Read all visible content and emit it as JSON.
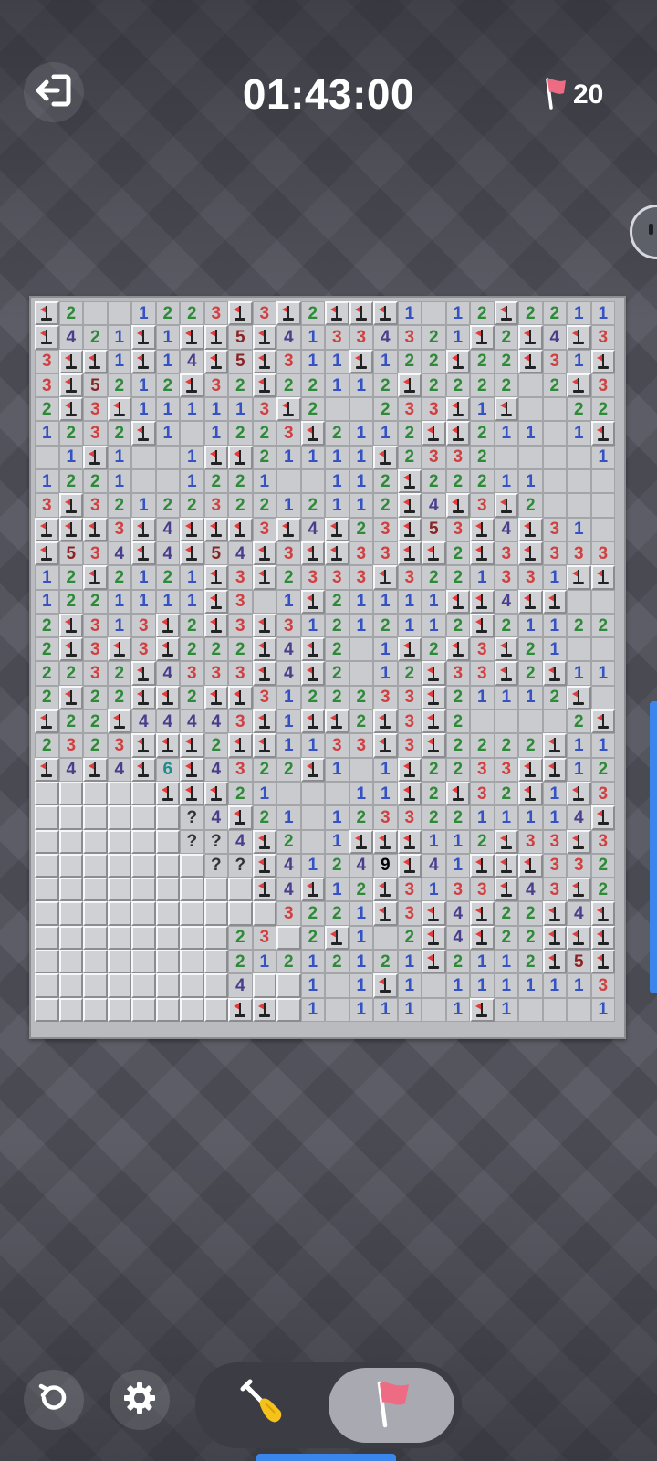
{
  "header": {
    "timer": "01:43:00",
    "flags_remaining": "20"
  },
  "colors": {
    "n1": "#3552c4",
    "n2": "#2d8a37",
    "n3": "#d14040",
    "n4": "#4a3e8c",
    "n5": "#8a2323",
    "n6": "#1e8c88",
    "flag_red": "#e33b3b",
    "flag_pink": "#ee6b84",
    "accent_blue": "#3b86ec"
  },
  "icons": {
    "exit": "exit-icon",
    "flag": "flag-icon",
    "restart": "restart-icon",
    "settings": "gear-icon",
    "dig": "shovel-icon",
    "side": "companion-face-icon"
  },
  "board": {
    "cols": 24,
    "rows": 30,
    "legend": {
      "F": "flagged",
      "#": "covered",
      ".": "revealed-empty",
      "?": "question-mark"
    },
    "rows_data": [
      "F2..1223F3F2FFF1.12F2211",
      "F421F1FF5F41334321F2F4F3F3",
      "3FF1F14F5F311F122F22F31F4FF",
      "3F5212F32F22112F2222.2F3",
      "2F3F111113F2..233F1F..222",
      "1232F1.1223F2112FF211.1F1",
      ".1F1..1FF21111F2332....111",
      "1221..1221..112F22211...",
      "3F3212232212112F4F3F2...",
      "FFF3F4FFF3F4F23F53F4F31..",
      "F534F4F54F3FF33FF2F3F3332",
      "12F2121F3F2333F3221331FFF",
      "1221111F3.1F21111FF4FF",
      "2F313F2F3F31212112F21122",
      "2F3F3F222F4F2.1F2F3F21..",
      "2232F4333F4F2.12F33F2F111",
      "2F22FF2FF3122233F21112F",
      "F22F44443F1FF2F3F2....2F",
      "2323FFF2FF1133F3F2222F1122",
      "F4F4F6F4322F1.1F2233FF1243",
      "#####FFF21...11F2F32F1F3FF",
      "######?4F21.12332211114F#",
      "######??4F2.1FFF112F33F3FF",
      "#######??F41249F41FFF3322",
      "#########F4F12F3133F43F2F1",
      "##########3221F3F4F22F4FF1",
      "########23#2F1.2F4F22FFF42",
      "########21212121F2112F5F3",
      "########4##1.1F1.1111113FF",
      "########FF#1.111.1F1...122"
    ]
  }
}
